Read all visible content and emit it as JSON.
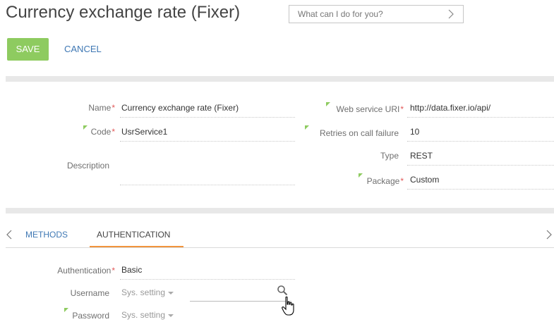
{
  "page": {
    "title": "Currency exchange rate (Fixer)",
    "search_placeholder": "What can I do for you?"
  },
  "toolbar": {
    "save_label": "SAVE",
    "cancel_label": "CANCEL"
  },
  "form": {
    "name": {
      "label": "Name",
      "required": "*",
      "value": "Currency exchange rate (Fixer)"
    },
    "code": {
      "label": "Code",
      "required": "*",
      "value": "UsrService1"
    },
    "description": {
      "label": "Description",
      "value": ""
    },
    "uri": {
      "label": "Web service URI",
      "required": "*",
      "value": "http://data.fixer.io/api/"
    },
    "retries": {
      "label": "Retries on call failure",
      "value": "10"
    },
    "type": {
      "label": "Type",
      "value": "REST"
    },
    "package": {
      "label": "Package",
      "required": "*",
      "value": "Custom"
    }
  },
  "tabs": [
    {
      "label": "METHODS",
      "active": false
    },
    {
      "label": "AUTHENTICATION",
      "active": true
    }
  ],
  "auth": {
    "authentication": {
      "label": "Authentication",
      "required": "*",
      "value": "Basic"
    },
    "username": {
      "label": "Username",
      "value": "Sys. setting"
    },
    "password": {
      "label": "Password",
      "value": "Sys. setting"
    }
  },
  "colors": {
    "accent_green": "#8ecb60",
    "link_blue": "#3f78b4",
    "required_red": "#e25858",
    "tab_underline": "#f1943d"
  },
  "icons": [
    "chevron-right-icon",
    "chevron-left-icon",
    "search-icon",
    "hand-cursor-icon",
    "dropdown-caret-icon"
  ]
}
